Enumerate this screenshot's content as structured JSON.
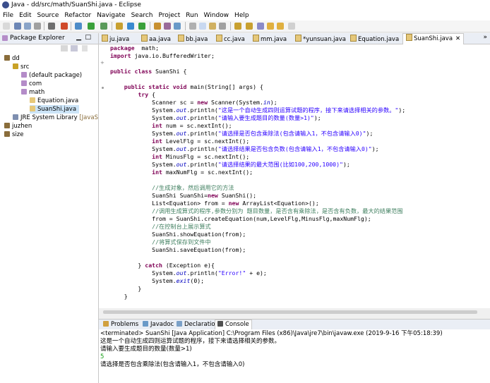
{
  "window": {
    "title": "Java - dd/src/math/SuanShi.java - Eclipse"
  },
  "menu": [
    "File",
    "Edit",
    "Source",
    "Refactor",
    "Navigate",
    "Search",
    "Project",
    "Run",
    "Window",
    "Help"
  ],
  "explorer": {
    "title": "Package Explorer",
    "items": [
      {
        "label": "dd",
        "indent": 0,
        "icon": "project-icon",
        "color": "#8a6d3b"
      },
      {
        "label": "src",
        "indent": 1,
        "icon": "source-folder-icon",
        "color": "#c9a227"
      },
      {
        "label": "(default package)",
        "indent": 2,
        "icon": "package-icon",
        "color": "#b48cc8"
      },
      {
        "label": "com",
        "indent": 2,
        "icon": "package-icon",
        "color": "#b48cc8"
      },
      {
        "label": "math",
        "indent": 2,
        "icon": "package-icon",
        "color": "#b48cc8"
      },
      {
        "label": "Equation.java",
        "indent": 3,
        "icon": "java-file-icon",
        "color": "#e6c87a"
      },
      {
        "label": "SuanShi.java",
        "indent": 3,
        "icon": "java-file-icon",
        "color": "#e6c87a",
        "selected": true
      },
      {
        "label": "JRE System Library",
        "indent": 1,
        "icon": "library-icon",
        "color": "#7e8fb0",
        "suffix": "[JavaS"
      },
      {
        "label": "juzhen",
        "indent": 0,
        "icon": "project-icon",
        "color": "#8a6d3b"
      },
      {
        "label": "size",
        "indent": 0,
        "icon": "project-icon",
        "color": "#8a6d3b"
      }
    ]
  },
  "tabs": [
    "ju.java",
    "aa.java",
    "bb.java",
    "cc.java",
    "mm.java",
    "*yunsuan.java",
    "Equation.java",
    "SuanShi.java"
  ],
  "active_tab": "SuanShi.java",
  "code": [
    [
      [
        "kw",
        "package"
      ],
      [
        "",
        "  math;"
      ]
    ],
    [
      [
        "kw",
        "import"
      ],
      [
        "",
        " java.io.BufferedWriter;"
      ]
    ],
    [
      [
        "",
        ""
      ]
    ],
    [
      [
        "kw",
        "public"
      ],
      [
        "",
        " "
      ],
      [
        "kw",
        "class"
      ],
      [
        "",
        " SuanShi {"
      ]
    ],
    [
      [
        "",
        ""
      ]
    ],
    [
      [
        "",
        "    "
      ],
      [
        "kw",
        "public"
      ],
      [
        "",
        " "
      ],
      [
        "kw",
        "static"
      ],
      [
        "",
        " "
      ],
      [
        "kw",
        "void"
      ],
      [
        "",
        " main(String[] args) {"
      ]
    ],
    [
      [
        "",
        "        "
      ],
      [
        "kw",
        "try"
      ],
      [
        "",
        " {"
      ]
    ],
    [
      [
        "",
        "            Scanner sc = "
      ],
      [
        "kw",
        "new"
      ],
      [
        "",
        " Scanner(System."
      ],
      [
        "fd",
        "in"
      ],
      [
        "",
        ");"
      ]
    ],
    [
      [
        "",
        "            System."
      ],
      [
        "fd",
        "out"
      ],
      [
        "",
        ".println("
      ],
      [
        "st",
        "\"这是一个自动生成四则运算试题的程序，接下来请选择相关的参数。\""
      ],
      [
        "",
        ");"
      ]
    ],
    [
      [
        "",
        "            System."
      ],
      [
        "fd",
        "out"
      ],
      [
        "",
        ".println("
      ],
      [
        "st",
        "\"请输入要生成题目的数量(数量>1)\""
      ],
      [
        "",
        ");"
      ]
    ],
    [
      [
        "",
        "            "
      ],
      [
        "kw",
        "int"
      ],
      [
        "",
        " num = sc.nextInt();"
      ]
    ],
    [
      [
        "",
        "            System."
      ],
      [
        "fd",
        "out"
      ],
      [
        "",
        ".println("
      ],
      [
        "st",
        "\"请选择是否包含乘除法(包含请输入1，不包含请输入0)\""
      ],
      [
        "",
        ");"
      ]
    ],
    [
      [
        "",
        "            "
      ],
      [
        "kw",
        "int"
      ],
      [
        "",
        " LevelFlg = sc.nextInt();"
      ]
    ],
    [
      [
        "",
        "            System."
      ],
      [
        "fd",
        "out"
      ],
      [
        "",
        ".println("
      ],
      [
        "st",
        "\"请选择结果是否包含负数(包含请输入1，不包含请输入0)\""
      ],
      [
        "",
        ");"
      ]
    ],
    [
      [
        "",
        "            "
      ],
      [
        "kw",
        "int"
      ],
      [
        "",
        " MinusFlg = sc.nextInt();"
      ]
    ],
    [
      [
        "",
        "            System."
      ],
      [
        "fd",
        "out"
      ],
      [
        "",
        ".println("
      ],
      [
        "st",
        "\"请选择结果的最大范围(比如100,200,1000)\""
      ],
      [
        "",
        ");"
      ]
    ],
    [
      [
        "",
        "            "
      ],
      [
        "kw",
        "int"
      ],
      [
        "",
        " maxNumFlg = sc.nextInt();"
      ]
    ],
    [
      [
        "",
        ""
      ]
    ],
    [
      [
        "",
        "            "
      ],
      [
        "cm",
        "//生成对象，然后调用它的方法"
      ]
    ],
    [
      [
        "",
        "            SuanShi SuanShi="
      ],
      [
        "kw",
        "new"
      ],
      [
        "",
        " SuanShi();"
      ]
    ],
    [
      [
        "",
        "            List<Equation> from = "
      ],
      [
        "kw",
        "new"
      ],
      [
        "",
        " ArrayList<Equation>();"
      ]
    ],
    [
      [
        "",
        "            "
      ],
      [
        "cm",
        "//调用生成算式的程序,参数分别为 题目数量，是否含有乘除法，是否含有负数，最大的结果范围"
      ]
    ],
    [
      [
        "",
        "            from = SuanShi.createEquation(num,LevelFlg,MinusFlg,maxNumFlg);"
      ]
    ],
    [
      [
        "",
        "            "
      ],
      [
        "cm",
        "//在控制台上展示算式"
      ]
    ],
    [
      [
        "",
        "            SuanShi.showEquation(from);"
      ]
    ],
    [
      [
        "",
        "            "
      ],
      [
        "cm",
        "//将算式保存到文件中"
      ]
    ],
    [
      [
        "",
        "            SuanShi.saveEquation(from);"
      ]
    ],
    [
      [
        "",
        ""
      ]
    ],
    [
      [
        "",
        "        } "
      ],
      [
        "kw",
        "catch"
      ],
      [
        "",
        " (Exception e){"
      ]
    ],
    [
      [
        "",
        "            System."
      ],
      [
        "fd",
        "out"
      ],
      [
        "",
        ".println("
      ],
      [
        "st",
        "\"Error!\""
      ],
      [
        "",
        " + e);"
      ]
    ],
    [
      [
        "",
        "            System."
      ],
      [
        "fd",
        "exit"
      ],
      [
        "",
        "(0);"
      ]
    ],
    [
      [
        "",
        "        }"
      ]
    ],
    [
      [
        "",
        "    }"
      ]
    ]
  ],
  "bottom_tabs": [
    "Problems",
    "Javadoc",
    "Declaration",
    "Console"
  ],
  "active_bottom_tab": "Console",
  "console": {
    "header": "<terminated> SuanShi [Java Application] C:\\Program Files (x86)\\Java\\jre7\\bin\\javaw.exe (2019-9-16 下午05:18:39)",
    "lines": [
      {
        "text": "这是一个自动生成四则运算试题的程序，接下来请选择相关的参数。",
        "color": "#000"
      },
      {
        "text": "请输入要生成题目的数量(数量>1)",
        "color": "#000"
      },
      {
        "text": "5",
        "color": "#18a018"
      },
      {
        "text": "请选择是否包含乘除法(包含请输入1，不包含请输入0)",
        "color": "#000"
      }
    ]
  }
}
